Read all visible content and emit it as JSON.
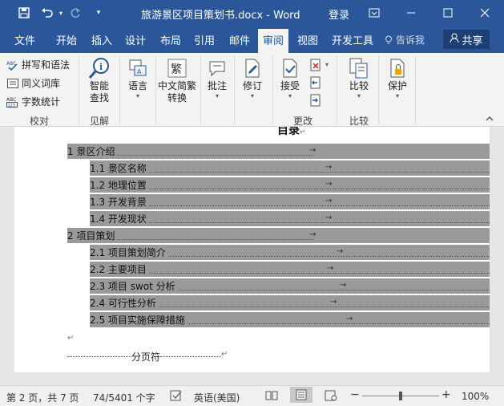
{
  "titlebar": {
    "save_icon": "save-icon",
    "undo_icon": "undo-icon",
    "redo_icon": "redo-icon",
    "customize_icon": "customize-quick-access-icon",
    "doc_title": "旅游景区项目策划书.docx  -  Word",
    "login": "登录",
    "ribbon_display_icon": "ribbon-display-options-icon"
  },
  "tabs": [
    {
      "label": "文件"
    },
    {
      "label": "开始"
    },
    {
      "label": "插入"
    },
    {
      "label": "设计"
    },
    {
      "label": "布局"
    },
    {
      "label": "引用"
    },
    {
      "label": "邮件"
    },
    {
      "label": "审阅"
    },
    {
      "label": "视图"
    },
    {
      "label": "开发工具"
    }
  ],
  "tellme": "告诉我",
  "share": "共享",
  "ribbon": {
    "proofing": {
      "spelling": "拼写和语法",
      "thesaurus": "同义词库",
      "wordcount": "字数统计",
      "group": "校对"
    },
    "insights": {
      "smart_lookup_1": "智能",
      "smart_lookup_2": "查找",
      "group": "见解"
    },
    "language": {
      "label": "语言"
    },
    "chinese": {
      "label_1": "中文简繁",
      "label_2": "转换"
    },
    "comments": {
      "label": "批注"
    },
    "tracking": {
      "label": "修订"
    },
    "changes": {
      "accept": "接受",
      "group": "更改"
    },
    "compare": {
      "label": "比较",
      "group": "比较"
    },
    "protect": {
      "label": "保护"
    }
  },
  "document": {
    "heading": "目录",
    "toc": [
      {
        "text": "1  景区介绍",
        "level": 1
      },
      {
        "text": "1.1  景区名称",
        "level": 2
      },
      {
        "text": "1.2  地理位置",
        "level": 2
      },
      {
        "text": "1.3  开发背景",
        "level": 2
      },
      {
        "text": "1.4  开发现状",
        "level": 2
      },
      {
        "text": "2  项目策划",
        "level": 1
      },
      {
        "text": "2.1  项目策划简介",
        "level": 2
      },
      {
        "text": "2.2  主要项目",
        "level": 2
      },
      {
        "text": "2.3  项目 swot 分析",
        "level": 2
      },
      {
        "text": "2.4  可行性分析",
        "level": 2
      },
      {
        "text": "2.5  项目实施保障措施",
        "level": 2
      }
    ],
    "page_break": "分页符"
  },
  "statusbar": {
    "page": "第 2 页，共 7 页",
    "words": "74/5401 个字",
    "language": "英语(美国)",
    "zoom": "100%",
    "zoom_level": 1.0
  },
  "colors": {
    "brand": "#2b579a",
    "selection": "#9a9a9a"
  }
}
